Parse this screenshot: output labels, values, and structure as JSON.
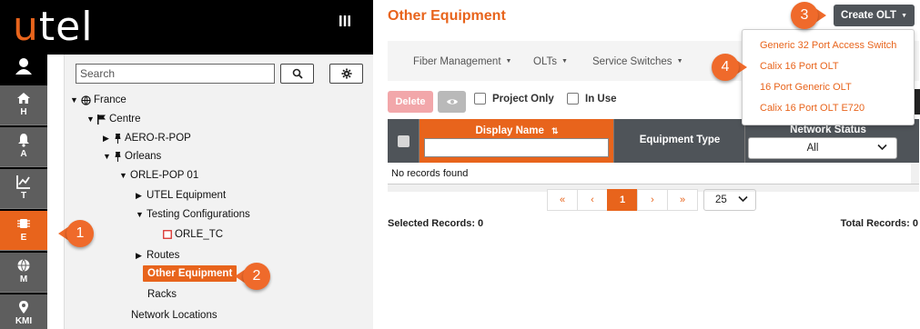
{
  "app": {
    "logo_u": "u",
    "logo_rest": "tel"
  },
  "rail": {
    "items": [
      {
        "label": "H",
        "icon": "home-icon"
      },
      {
        "label": "A",
        "icon": "bell-icon"
      },
      {
        "label": "T",
        "icon": "chart-icon"
      },
      {
        "label": "E",
        "icon": "chip-icon"
      },
      {
        "label": "M",
        "icon": "globe-icon"
      },
      {
        "label": "KMI",
        "icon": "pin-icon"
      }
    ]
  },
  "search": {
    "placeholder": "Search"
  },
  "tree": {
    "france": "France",
    "centre": "Centre",
    "aero": "AERO-R-POP",
    "orleans": "Orleans",
    "orle_pop": "ORLE-POP 01",
    "utel_equipment": "UTEL Equipment",
    "testing_configurations": "Testing Configurations",
    "orle_tc": "ORLE_TC",
    "routes": "Routes",
    "other_equipment": "Other Equipment",
    "racks": "Racks",
    "network_locations": "Network Locations"
  },
  "page": {
    "title": "Other Equipment",
    "create_olt": "Create OLT"
  },
  "subnav": [
    "Fiber Management",
    "OLTs",
    "Service Switches"
  ],
  "toolbar": {
    "delete": "Delete",
    "project_only": "Project Only",
    "in_use": "In Use"
  },
  "grid": {
    "col_display_name": "Display Name",
    "col_equipment_type": "Equipment Type",
    "col_network_status": "Network Status",
    "status_value": "All",
    "empty": "No records found"
  },
  "pager": {
    "first": "«",
    "prev": "‹",
    "current": "1",
    "next": "›",
    "last": "»",
    "page_size": "25"
  },
  "footer": {
    "selected": "Selected Records: 0",
    "total": "Total Records: 0"
  },
  "olt_menu": [
    "Generic 32 Port Access Switch",
    "Calix 16 Port OLT",
    "16 Port Generic OLT",
    "Calix 16 Port OLT E720"
  ],
  "callouts": [
    "1",
    "2",
    "3",
    "4"
  ],
  "colors": {
    "accent": "#e8641c",
    "dark": "#4f5459",
    "rail": "#5e5e5e"
  }
}
